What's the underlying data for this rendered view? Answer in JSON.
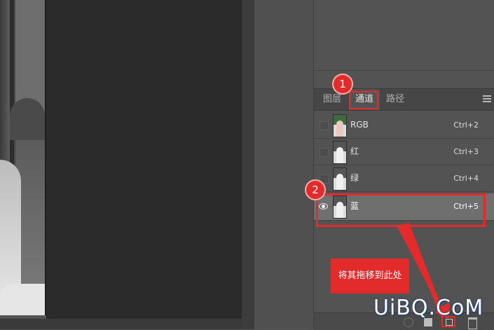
{
  "panel": {
    "tabs": [
      {
        "label": "图层",
        "active": false
      },
      {
        "label": "通道",
        "active": true
      },
      {
        "label": "路径",
        "active": false
      }
    ],
    "menu_icon": "panel-menu-icon",
    "channels": [
      {
        "name": "RGB",
        "shortcut": "Ctrl+2",
        "visible": false,
        "selected": false
      },
      {
        "name": "红",
        "shortcut": "Ctrl+3",
        "visible": false,
        "selected": false
      },
      {
        "name": "绿",
        "shortcut": "Ctrl+4",
        "visible": false,
        "selected": false
      },
      {
        "name": "蓝",
        "shortcut": "Ctrl+5",
        "visible": true,
        "selected": true
      }
    ]
  },
  "annotations": {
    "badge1": "1",
    "badge2": "2",
    "callout": "将其拖移到此处"
  },
  "bottom_bar": {
    "icons": [
      "load-selection-icon",
      "save-selection-mask-icon",
      "new-channel-icon",
      "trash-icon"
    ]
  },
  "watermark": "UiBQ.CoM",
  "colors": {
    "annotation": "#e32b2b",
    "selected_row": "#6f6f6f",
    "panel_bg": "#535353"
  }
}
